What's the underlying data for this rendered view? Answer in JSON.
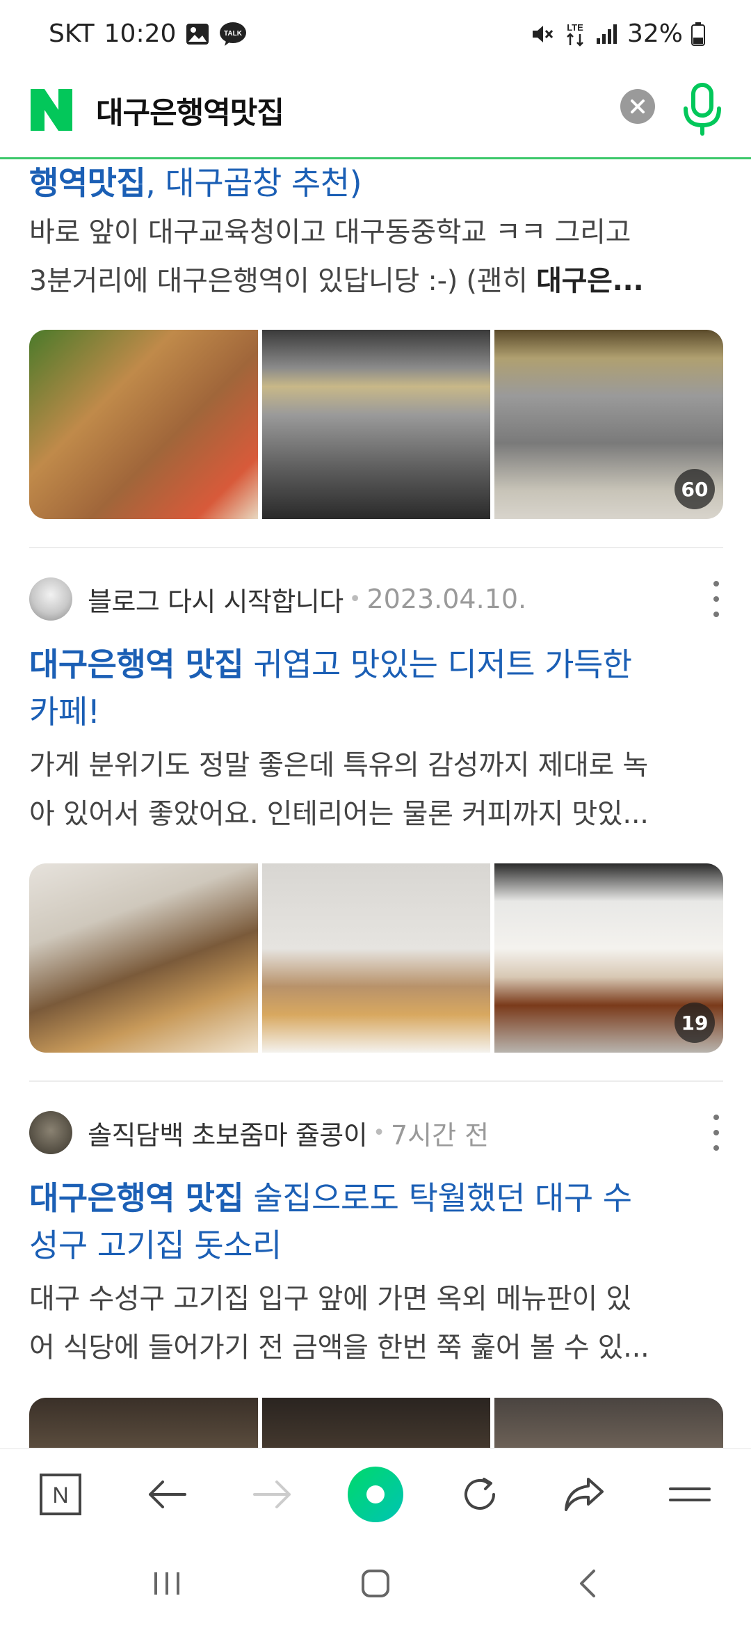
{
  "status_bar": {
    "carrier": "SKT",
    "time": "10:20",
    "network": "LTE",
    "battery": "32%",
    "icons": [
      "gallery-icon",
      "talk-icon",
      "mute-icon",
      "lte-icon",
      "signal-icon",
      "battery-icon"
    ],
    "talk_label": "TALK"
  },
  "search": {
    "logo_letter": "N",
    "query": "대구은행역맛집",
    "brand_color": "#03c75a"
  },
  "results": [
    {
      "title_highlight": "행역맛집",
      "title_rest": ", 대구곱창 추천)",
      "snippet_lines": [
        "바로 앞이 대구교육청이고 대구동중학교 ㅋㅋ 그리고",
        "3분거리에 대구은행역이 있답니당 :-) (괜히 "
      ],
      "snippet_bold_tail": "대구은...",
      "image_count": "60"
    },
    {
      "author": "블로그 다시 시작합니다",
      "date": "2023.04.10.",
      "title_highlight": "대구은행역 맛집",
      "title_rest": " 귀엽고 맛있는 디저트 가득한",
      "title_line2": "카페!",
      "snippet_lines": [
        "가게 분위기도 정말 좋은데 특유의 감성까지 제대로 녹",
        "아 있어서 좋았어요. 인테리어는 물론 커피까지 맛있..."
      ],
      "image_count": "19"
    },
    {
      "author": "솔직담백 초보줌마 쥴콩이",
      "date": "7시간 전",
      "title_highlight": "대구은행역 맛집",
      "title_rest": " 술집으로도 탁월했던 대구 수",
      "title_line2": "성구 고기집 돗소리",
      "snippet_lines": [
        "대구 수성구 고기집 입구 앞에 가면 옥외 메뉴판이 있",
        "어 식당에 들어가기 전 금액을 한번 쭉 훑어 볼 수 있..."
      ]
    }
  ],
  "toolbar": {
    "home_letter": "N",
    "items": [
      "naver-home-icon",
      "back-icon",
      "forward-icon",
      "green-dot-icon",
      "refresh-icon",
      "share-icon",
      "menu-icon"
    ],
    "accent": "#03c75a"
  },
  "navbar": {
    "items": [
      "recents-icon",
      "home-icon",
      "back-icon"
    ]
  }
}
